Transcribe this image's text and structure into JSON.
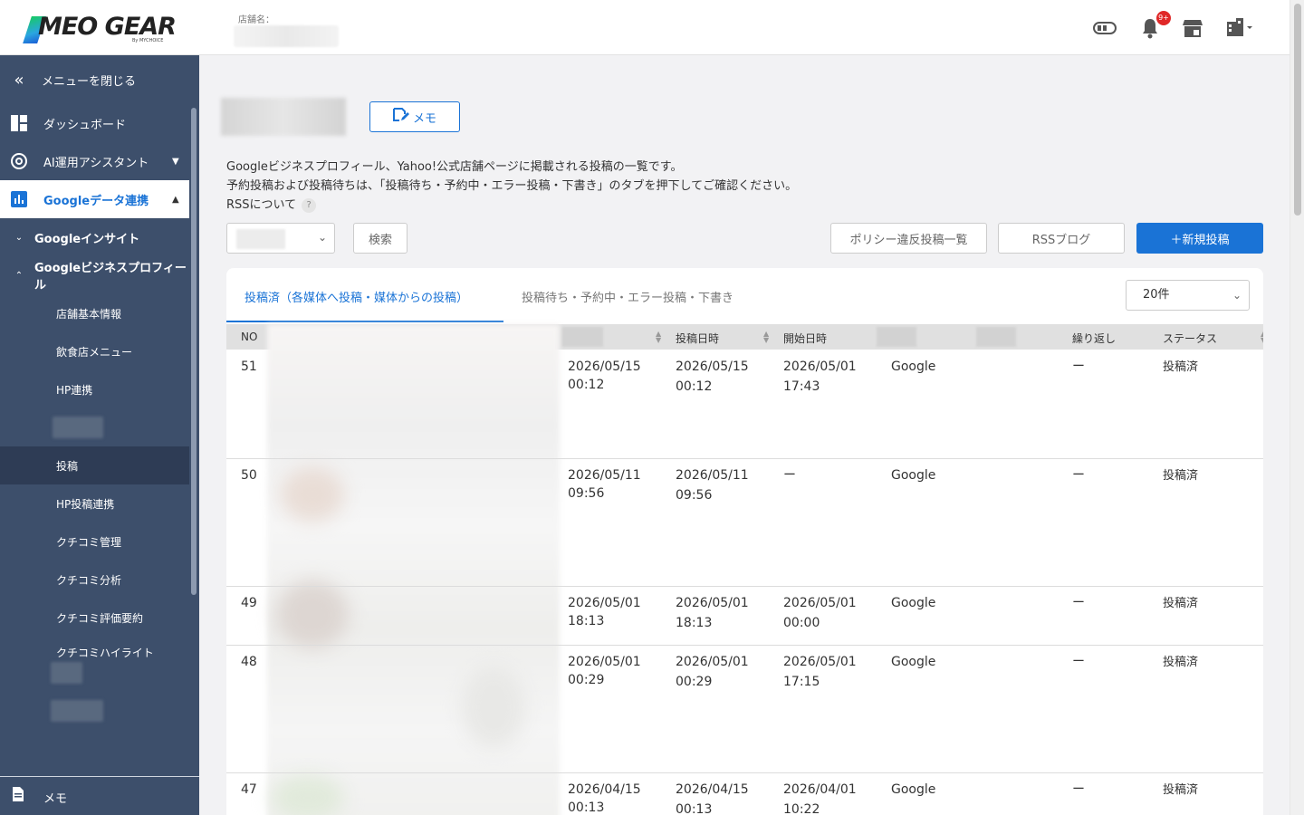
{
  "header": {
    "logo_text": "MEO GEAR",
    "logo_sub": "By MYCHOICE",
    "store_label": "店舗名：",
    "notification_count": "9+"
  },
  "sidebar": {
    "close_menu": "メニューを閉じる",
    "items": [
      {
        "label": "ダッシュボード",
        "icon": "dashboard-icon"
      },
      {
        "label": "AI運用アシスタント",
        "icon": "ai-icon"
      },
      {
        "label": "Googleデータ連携",
        "icon": "bar-chart-icon"
      },
      {
        "label": "Googleインサイト"
      },
      {
        "label": "Googleビジネスプロフィール"
      },
      {
        "label": "店舗基本情報"
      },
      {
        "label": "飲食店メニュー"
      },
      {
        "label": "HP連携"
      },
      {
        "label": "投稿"
      },
      {
        "label": "HP投稿連携"
      },
      {
        "label": "クチコミ管理"
      },
      {
        "label": "クチコミ分析"
      },
      {
        "label": "クチコミ評価要約"
      },
      {
        "label": "クチコミハイライト"
      }
    ],
    "bottom_memo": "メモ"
  },
  "main": {
    "memo_button": "メモ",
    "desc_line1": "Googleビジネスプロフィール、Yahoo!公式店舗ページに掲載される投稿の一覧です。",
    "desc_line2": "予約投稿および投稿待ちは、「投稿待ち・予約中・エラー投稿・下書き」のタブを押下してご確認ください。",
    "rss_about": "RSSについて",
    "help_mark": "?",
    "search_button": "検索",
    "policy_button": "ポリシー違反投稿一覧",
    "rss_blog_button": "RSSブログ",
    "new_post_button": "＋新規投稿",
    "tab_posted": "投稿済（各媒体へ投稿・媒体からの投稿）",
    "tab_pending": "投稿待ち・予約中・エラー投稿・下書き",
    "per_page": "20件"
  },
  "table": {
    "headers": {
      "no": "NO",
      "posted_at": "投稿日時",
      "start_at": "開始日時",
      "repeat": "繰り返し",
      "status": "ステータス"
    },
    "rows": [
      {
        "no": "51",
        "created_date": "2026/05/15",
        "created_time": "00:12",
        "posted_date": "2026/05/15",
        "posted_time": "00:12",
        "start_date": "2026/05/01",
        "start_time": "17:43",
        "media": "Google",
        "repeat": "ー",
        "status": "投稿済"
      },
      {
        "no": "50",
        "created_date": "2026/05/11",
        "created_time": "09:56",
        "posted_date": "2026/05/11",
        "posted_time": "09:56",
        "start_date": "ー",
        "start_time": "",
        "media": "Google",
        "repeat": "ー",
        "status": "投稿済"
      },
      {
        "no": "49",
        "created_date": "2026/05/01",
        "created_time": "18:13",
        "posted_date": "2026/05/01",
        "posted_time": "18:13",
        "start_date": "2026/05/01",
        "start_time": "00:00",
        "media": "Google",
        "repeat": "ー",
        "status": "投稿済"
      },
      {
        "no": "48",
        "created_date": "2026/05/01",
        "created_time": "00:29",
        "posted_date": "2026/05/01",
        "posted_time": "00:29",
        "start_date": "2026/05/01",
        "start_time": "17:15",
        "media": "Google",
        "repeat": "ー",
        "status": "投稿済"
      },
      {
        "no": "47",
        "created_date": "2026/04/15",
        "created_time": "00:13",
        "posted_date": "2026/04/15",
        "posted_time": "00:13",
        "start_date": "2026/04/01",
        "start_time": "10:22",
        "media": "Google",
        "repeat": "ー",
        "status": "投稿済"
      }
    ]
  },
  "colors": {
    "sidebar_bg": "#3d4f6b",
    "accent": "#1a73d6",
    "badge": "#e02828"
  }
}
